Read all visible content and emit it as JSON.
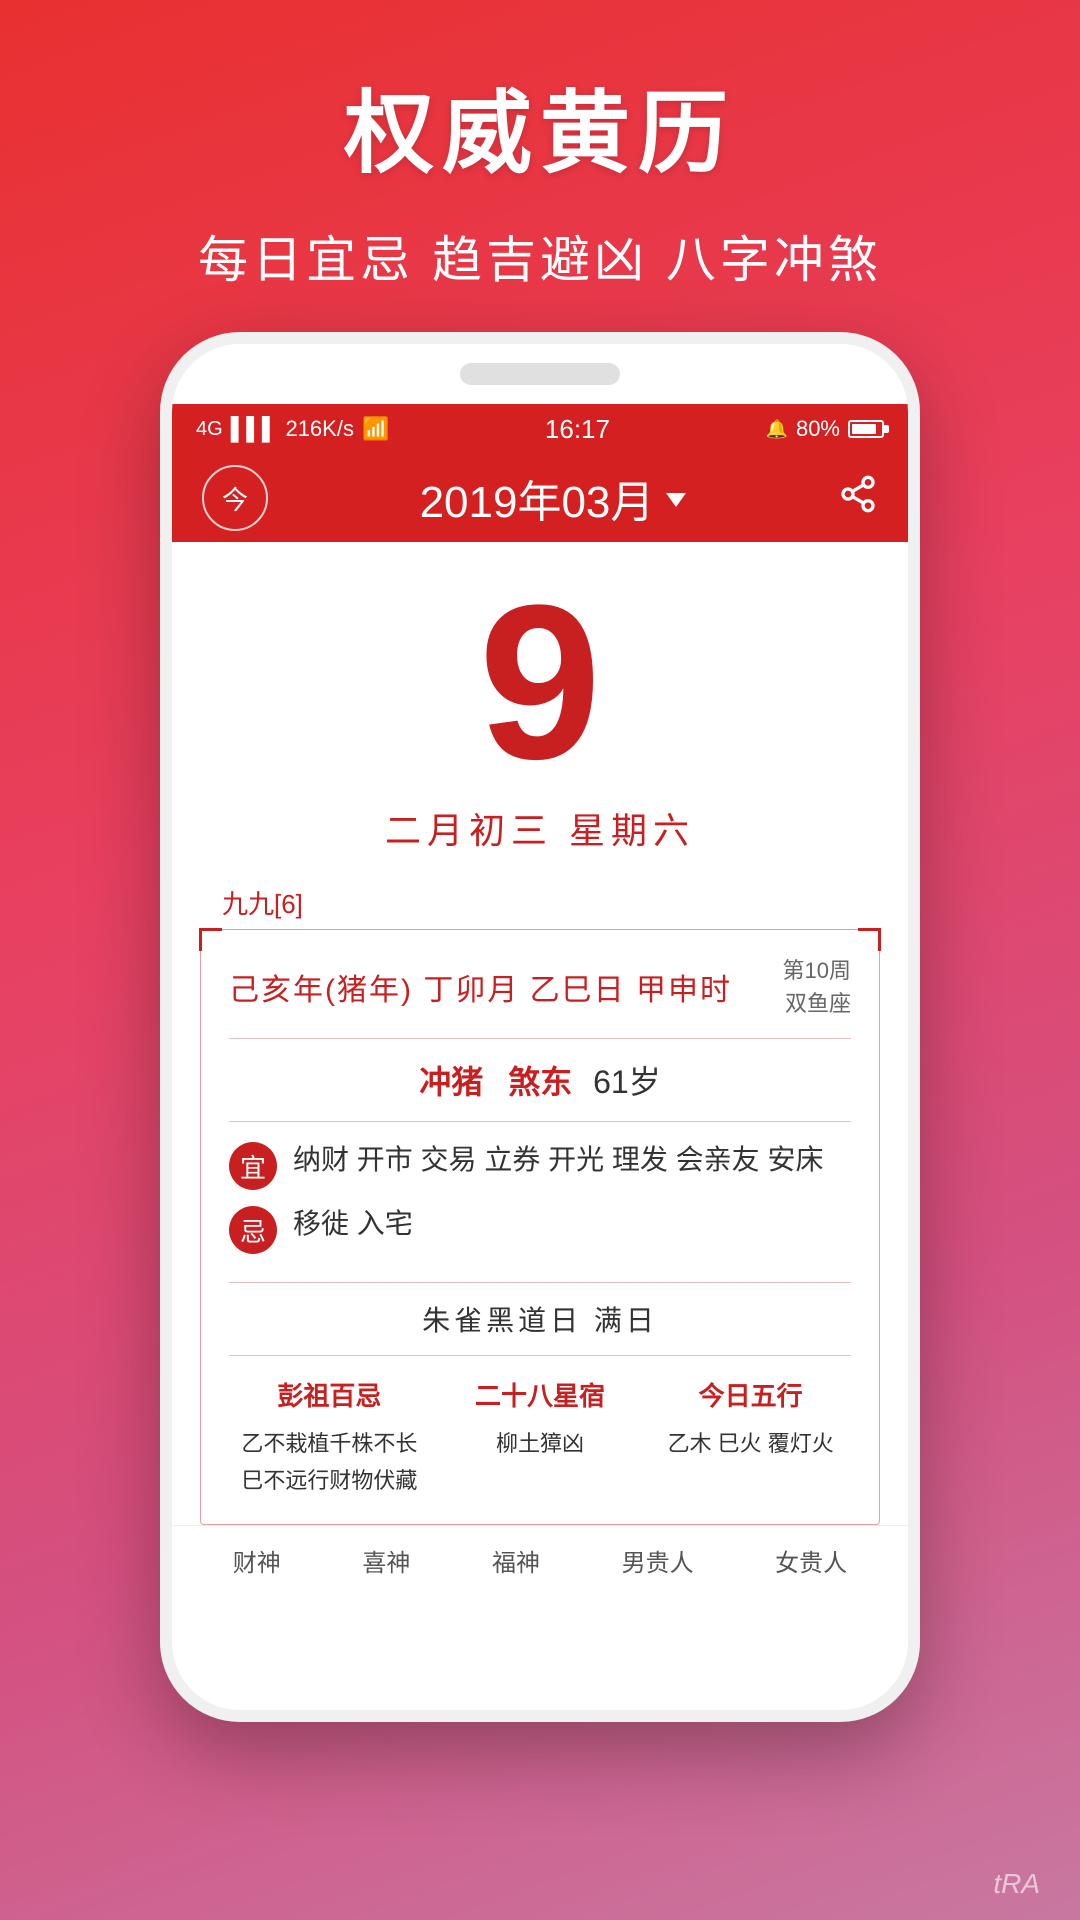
{
  "hero": {
    "title": "权威黄历",
    "subtitle": "每日宜忌 趋吉避凶 八字冲煞"
  },
  "status_bar": {
    "signal": "4G",
    "speed": "216K/s",
    "wifi": "WiFi",
    "time": "16:17",
    "alarm": "🔔",
    "battery_pct": "80%"
  },
  "app_header": {
    "today_label": "今",
    "month_title": "2019年03月",
    "dropdown_label": "▼"
  },
  "calendar": {
    "day_number": "9",
    "lunar_date": "二月初三  星期六"
  },
  "nine_nine": {
    "label": "九九[6]"
  },
  "card": {
    "ganzhi": "己亥年(猪年) 丁卯月 乙巳日 甲申时",
    "week_label": "第10周",
    "zodiac": "双鱼座",
    "chong": "冲猪",
    "sha": "煞东",
    "age": "61岁",
    "yi_label": "宜",
    "yi_text": "纳财 开市 交易 立券 开光 理发 会亲友 安床",
    "ji_label": "忌",
    "ji_text": "移徙 入宅",
    "zhuri": "朱雀黑道日  满日",
    "peng_zu_title": "彭祖百忌",
    "peng_za_text1": "乙不栽植千株不长",
    "peng_za_text2": "巳不远行财物伏藏",
    "xiu_title": "二十八星宿",
    "xiu_text": "柳土獐凶",
    "wuxing_title": "今日五行",
    "wuxing_text": "乙木 巳火 覆灯火"
  },
  "bottom_nav": [
    "财神",
    "喜神",
    "福神",
    "男贵人",
    "女贵人"
  ],
  "watermark": "tRA"
}
